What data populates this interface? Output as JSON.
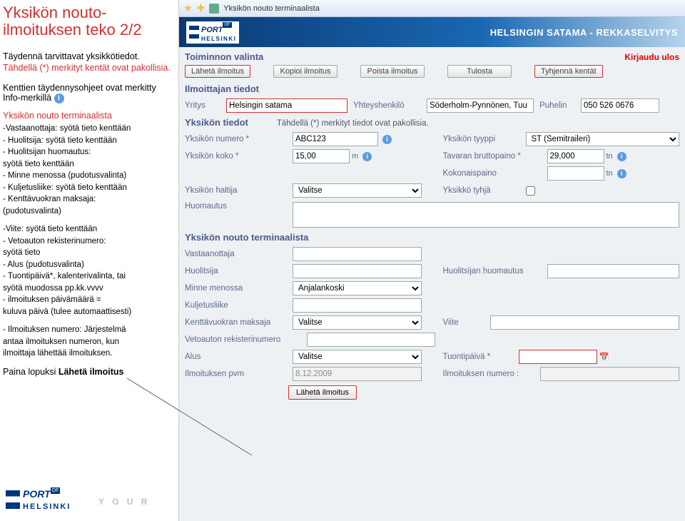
{
  "left": {
    "title": "Yksikön nouto-ilmoituksen teko 2/2",
    "intro1": "Täydennä tarvittavat yksikkötiedot.",
    "intro2": "Tähdellä (*) merkityt kentät ovat pakollisia.",
    "subhead_a": "Kenttien täydennysohjeet ovat merkitty Info-merkillä",
    "section_label": "Yksikön nouto terminaalista",
    "bullets1": [
      "-Vastaanottaja: syötä tieto kenttään",
      "- Huolitsija: syötä tieto kenttään",
      "- Huolitsijan huomautus:",
      "  syötä tieto kenttään",
      "- Minne menossa (pudotusvalinta)",
      "- Kuljetusliike: syötä tieto kenttään",
      "- Kenttävuokran maksaja:",
      "  (pudotusvalinta)"
    ],
    "bullets2": [
      "-Viite: syötä tieto kenttään",
      "- Vetoauton rekisterinumero:",
      "  syötä tieto",
      "- Alus (pudotusvalinta)",
      "- Tuontipäivä*, kalenterivalinta, tai",
      "syötä muodossa pp.kk.vvvv",
      "- ilmoituksen päivämäärä =",
      "  kuluva päivä (tulee automaattisesti)"
    ],
    "bullets3": [
      "- Ilmoituksen numero: Järjestelmä",
      "  antaa ilmoituksen numeron, kun",
      "  ilmoittaja lähettää ilmoituksen."
    ],
    "final": "Paina lopuksi Lähetä ilmoitus",
    "your": "Y O U R"
  },
  "browser": {
    "tab_title": "Yksikön nouto terminaalista"
  },
  "header": {
    "right": "HELSINGIN SATAMA - REKKASELVITYS",
    "port": "PORT",
    "of": "OF",
    "hels": "HELSINKI"
  },
  "top": {
    "label": "Toiminnon valinta",
    "logout": "Kirjaudu ulos"
  },
  "buttons": {
    "send": "Lähetä ilmoitus",
    "copy": "Kopioi ilmoitus",
    "delete": "Poista ilmoitus",
    "print": "Tulosta",
    "clear": "Tyhjennä kentät"
  },
  "sec1": {
    "title": "Ilmoittajan tiedot",
    "company_l": "Yritys",
    "company_v": "Helsingin satama",
    "contact_l": "Yhteyshenkilö",
    "contact_v": "Söderholm-Pynnönen, Tuu",
    "phone_l": "Puhelin",
    "phone_v": "050 526 0676"
  },
  "sec2": {
    "title": "Yksikön tiedot",
    "mandatory": "Tähdellä (*) merkityt tiedot ovat pakollisia.",
    "num_l": "Yksikön numero *",
    "num_v": "ABC123",
    "type_l": "Yksikön tyyppi",
    "type_v": "ST (Semitraileri)",
    "size_l": "Yksikön koko *",
    "size_v": "15,00",
    "size_unit": "m",
    "gross_l": "Tavaran bruttopaino *",
    "gross_v": "29,000",
    "gross_unit": "tn",
    "totalw_l": "Kokonaispaino",
    "totalw_v": "",
    "totalw_unit": "tn",
    "holder_l": "Yksikön haltija",
    "holder_v": "Valitse",
    "empty_l": "Yksikkö tyhjä",
    "note_l": "Huomautus"
  },
  "sec3": {
    "title": "Yksikön nouto terminaalista",
    "recip_l": "Vastaanottaja",
    "fwd_l": "Huolitsija",
    "fwd_note_l": "Huolitsijan huomautus",
    "dest_l": "Minne menossa",
    "dest_v": "Anjalankoski",
    "carrier_l": "Kuljetusliike",
    "payer_l": "Kenttävuokran maksaja",
    "payer_v": "Valitse",
    "ref_l": "Viite",
    "reg_l": "Vetoauton rekisterinumero",
    "ship_l": "Alus",
    "ship_v": "Valitse",
    "import_l": "Tuontipäivä *",
    "date_l": "Ilmoituksen pvm",
    "date_v": "8.12.2009",
    "msgnum_l": "Ilmoituksen numero :",
    "submit": "Lähetä ilmoitus"
  }
}
